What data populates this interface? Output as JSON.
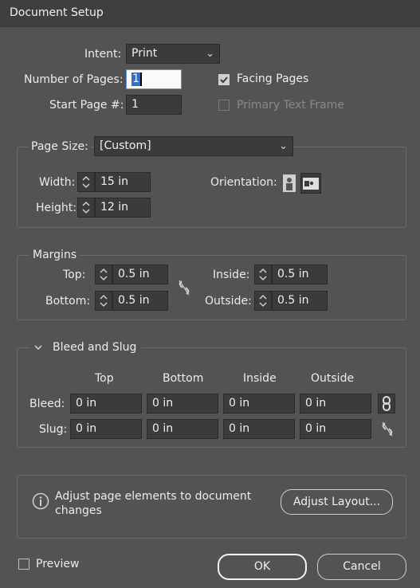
{
  "window": {
    "title": "Document Setup"
  },
  "intent": {
    "label": "Intent:",
    "value": "Print"
  },
  "pages": {
    "number_label": "Number of Pages:",
    "number_value": "1",
    "start_label": "Start Page #:",
    "start_value": "1",
    "facing_label": "Facing Pages",
    "facing_checked": true,
    "primary_label": "Primary Text Frame",
    "primary_checked": false
  },
  "page_size": {
    "label": "Page Size:",
    "value": "[Custom]",
    "width_label": "Width:",
    "width_value": "15 in",
    "height_label": "Height:",
    "height_value": "12 in",
    "orientation_label": "Orientation:",
    "orientation_selected": "landscape"
  },
  "margins": {
    "title": "Margins",
    "top_label": "Top:",
    "top_value": "0.5 in",
    "bottom_label": "Bottom:",
    "bottom_value": "0.5 in",
    "inside_label": "Inside:",
    "inside_value": "0.5 in",
    "outside_label": "Outside:",
    "outside_value": "0.5 in"
  },
  "bleed_slug": {
    "title": "Bleed and Slug",
    "columns": [
      "Top",
      "Bottom",
      "Inside",
      "Outside"
    ],
    "bleed_label": "Bleed:",
    "bleed_values": [
      "0 in",
      "0 in",
      "0 in",
      "0 in"
    ],
    "slug_label": "Slug:",
    "slug_values": [
      "0 in",
      "0 in",
      "0 in",
      "0 in"
    ]
  },
  "adjust": {
    "message": "Adjust page elements to document changes",
    "button_label": "Adjust Layout..."
  },
  "footer": {
    "preview_label": "Preview",
    "ok_label": "OK",
    "cancel_label": "Cancel"
  }
}
